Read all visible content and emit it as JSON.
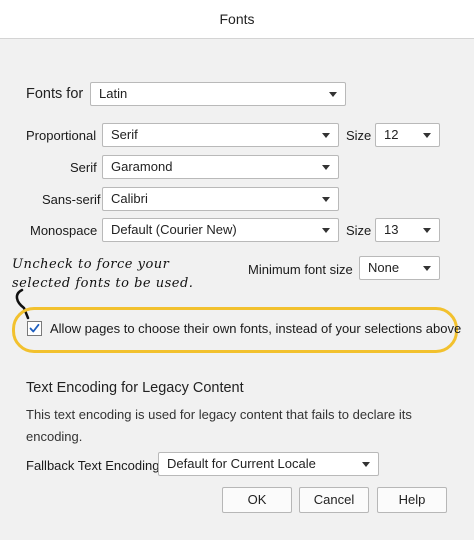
{
  "window": {
    "title": "Fonts"
  },
  "fonts_for": {
    "label": "Fonts for",
    "value": "Latin"
  },
  "proportional": {
    "label": "Proportional",
    "value": "Serif",
    "size_label": "Size",
    "size_value": "12"
  },
  "serif": {
    "label": "Serif",
    "value": "Garamond"
  },
  "sans_serif": {
    "label": "Sans-serif",
    "value": "Calibri"
  },
  "monospace": {
    "label": "Monospace",
    "value": "Default (Courier New)",
    "size_label": "Size",
    "size_value": "13"
  },
  "minimum_font": {
    "label": "Minimum font size",
    "value": "None"
  },
  "annotation": {
    "line1": "Uncheck to force your",
    "line2": "selected fonts to be used."
  },
  "allow_pages": {
    "label": "Allow pages to choose their own fonts, instead of your selections above",
    "checked": true
  },
  "encoding": {
    "heading": "Text Encoding for Legacy Content",
    "description": "This text encoding is used for legacy content that fails to declare its encoding.",
    "fallback_label": "Fallback Text Encoding",
    "fallback_value": "Default for Current Locale"
  },
  "buttons": {
    "ok": "OK",
    "cancel": "Cancel",
    "help": "Help"
  },
  "colors": {
    "highlight": "#f2c12e",
    "dialog_bg": "#f1f1f1"
  }
}
